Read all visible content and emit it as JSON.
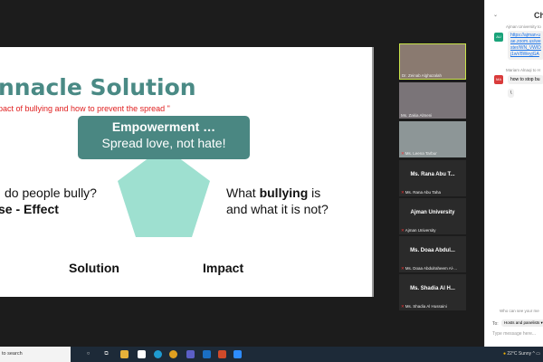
{
  "slide": {
    "title": "nnacle Solution",
    "subtitle": "pact of bullying and how to prevent the spread \"",
    "box_title": "Empowerment …",
    "box_text": "Spread love, not hate!",
    "left_q1": "do people bully?",
    "left_q2": "se - Effect",
    "right_q1_pre": "What ",
    "right_q1_bold": "bullying",
    "right_q1_post": " is",
    "right_q2": "and what it is not?",
    "solution": "Solution",
    "impact": "Impact",
    "pentagon_color": "#9ee0d0"
  },
  "participants": [
    {
      "label": "Dr. Zeinab Alghazalah",
      "video": true,
      "active": true
    },
    {
      "label": "Ms. Zakia Almeni",
      "video": true
    },
    {
      "label": "Ms. Leena Tarbur",
      "video": true,
      "muted": true
    },
    {
      "name": "Ms. Rana Abu T...",
      "label": "Ms. Rana Abu Taha",
      "muted": true
    },
    {
      "name": "Ajman University",
      "label": "Ajman University",
      "muted": true
    },
    {
      "name": "Ms. Doaa Abdul...",
      "label": "Ms. Doaa Abdulraheem Al-...",
      "muted": true
    },
    {
      "name": "Ms. Shadia Al H...",
      "label": "Ms. Shadia Al Hussaini",
      "muted": true
    }
  ],
  "chat": {
    "header": "Cha",
    "messages": [
      {
        "from": "Ajman University to",
        "avatar": "AU",
        "color": "#1aa37a",
        "lines": [
          "https://ajman-u",
          "ae.zoom.us/we",
          "ster/WN_VWID",
          "j1wV8WeyjGA"
        ]
      },
      {
        "from": "Mariam Alnaqi to H",
        "avatar": "MA",
        "color": "#d93b3b",
        "lines": [
          "how to stop bu"
        ]
      },
      {
        "lines": [
          "\\"
        ]
      }
    ],
    "who_can_see": "Who can see your me",
    "to_label": "To:",
    "to_value": "Hosts and panelists",
    "placeholder": "Type message here..."
  },
  "taskbar": {
    "search": "to search",
    "weather": "22°C  Sunny"
  }
}
